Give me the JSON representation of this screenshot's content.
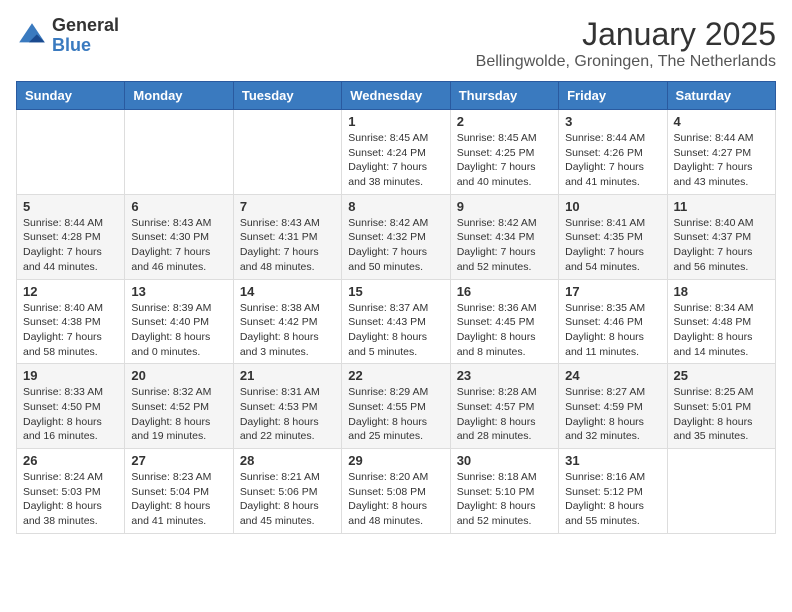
{
  "logo": {
    "general": "General",
    "blue": "Blue"
  },
  "header": {
    "month": "January 2025",
    "location": "Bellingwolde, Groningen, The Netherlands"
  },
  "weekdays": [
    "Sunday",
    "Monday",
    "Tuesday",
    "Wednesday",
    "Thursday",
    "Friday",
    "Saturday"
  ],
  "weeks": [
    [
      {
        "day": "",
        "info": ""
      },
      {
        "day": "",
        "info": ""
      },
      {
        "day": "",
        "info": ""
      },
      {
        "day": "1",
        "info": "Sunrise: 8:45 AM\nSunset: 4:24 PM\nDaylight: 7 hours\nand 38 minutes."
      },
      {
        "day": "2",
        "info": "Sunrise: 8:45 AM\nSunset: 4:25 PM\nDaylight: 7 hours\nand 40 minutes."
      },
      {
        "day": "3",
        "info": "Sunrise: 8:44 AM\nSunset: 4:26 PM\nDaylight: 7 hours\nand 41 minutes."
      },
      {
        "day": "4",
        "info": "Sunrise: 8:44 AM\nSunset: 4:27 PM\nDaylight: 7 hours\nand 43 minutes."
      }
    ],
    [
      {
        "day": "5",
        "info": "Sunrise: 8:44 AM\nSunset: 4:28 PM\nDaylight: 7 hours\nand 44 minutes."
      },
      {
        "day": "6",
        "info": "Sunrise: 8:43 AM\nSunset: 4:30 PM\nDaylight: 7 hours\nand 46 minutes."
      },
      {
        "day": "7",
        "info": "Sunrise: 8:43 AM\nSunset: 4:31 PM\nDaylight: 7 hours\nand 48 minutes."
      },
      {
        "day": "8",
        "info": "Sunrise: 8:42 AM\nSunset: 4:32 PM\nDaylight: 7 hours\nand 50 minutes."
      },
      {
        "day": "9",
        "info": "Sunrise: 8:42 AM\nSunset: 4:34 PM\nDaylight: 7 hours\nand 52 minutes."
      },
      {
        "day": "10",
        "info": "Sunrise: 8:41 AM\nSunset: 4:35 PM\nDaylight: 7 hours\nand 54 minutes."
      },
      {
        "day": "11",
        "info": "Sunrise: 8:40 AM\nSunset: 4:37 PM\nDaylight: 7 hours\nand 56 minutes."
      }
    ],
    [
      {
        "day": "12",
        "info": "Sunrise: 8:40 AM\nSunset: 4:38 PM\nDaylight: 7 hours\nand 58 minutes."
      },
      {
        "day": "13",
        "info": "Sunrise: 8:39 AM\nSunset: 4:40 PM\nDaylight: 8 hours\nand 0 minutes."
      },
      {
        "day": "14",
        "info": "Sunrise: 8:38 AM\nSunset: 4:42 PM\nDaylight: 8 hours\nand 3 minutes."
      },
      {
        "day": "15",
        "info": "Sunrise: 8:37 AM\nSunset: 4:43 PM\nDaylight: 8 hours\nand 5 minutes."
      },
      {
        "day": "16",
        "info": "Sunrise: 8:36 AM\nSunset: 4:45 PM\nDaylight: 8 hours\nand 8 minutes."
      },
      {
        "day": "17",
        "info": "Sunrise: 8:35 AM\nSunset: 4:46 PM\nDaylight: 8 hours\nand 11 minutes."
      },
      {
        "day": "18",
        "info": "Sunrise: 8:34 AM\nSunset: 4:48 PM\nDaylight: 8 hours\nand 14 minutes."
      }
    ],
    [
      {
        "day": "19",
        "info": "Sunrise: 8:33 AM\nSunset: 4:50 PM\nDaylight: 8 hours\nand 16 minutes."
      },
      {
        "day": "20",
        "info": "Sunrise: 8:32 AM\nSunset: 4:52 PM\nDaylight: 8 hours\nand 19 minutes."
      },
      {
        "day": "21",
        "info": "Sunrise: 8:31 AM\nSunset: 4:53 PM\nDaylight: 8 hours\nand 22 minutes."
      },
      {
        "day": "22",
        "info": "Sunrise: 8:29 AM\nSunset: 4:55 PM\nDaylight: 8 hours\nand 25 minutes."
      },
      {
        "day": "23",
        "info": "Sunrise: 8:28 AM\nSunset: 4:57 PM\nDaylight: 8 hours\nand 28 minutes."
      },
      {
        "day": "24",
        "info": "Sunrise: 8:27 AM\nSunset: 4:59 PM\nDaylight: 8 hours\nand 32 minutes."
      },
      {
        "day": "25",
        "info": "Sunrise: 8:25 AM\nSunset: 5:01 PM\nDaylight: 8 hours\nand 35 minutes."
      }
    ],
    [
      {
        "day": "26",
        "info": "Sunrise: 8:24 AM\nSunset: 5:03 PM\nDaylight: 8 hours\nand 38 minutes."
      },
      {
        "day": "27",
        "info": "Sunrise: 8:23 AM\nSunset: 5:04 PM\nDaylight: 8 hours\nand 41 minutes."
      },
      {
        "day": "28",
        "info": "Sunrise: 8:21 AM\nSunset: 5:06 PM\nDaylight: 8 hours\nand 45 minutes."
      },
      {
        "day": "29",
        "info": "Sunrise: 8:20 AM\nSunset: 5:08 PM\nDaylight: 8 hours\nand 48 minutes."
      },
      {
        "day": "30",
        "info": "Sunrise: 8:18 AM\nSunset: 5:10 PM\nDaylight: 8 hours\nand 52 minutes."
      },
      {
        "day": "31",
        "info": "Sunrise: 8:16 AM\nSunset: 5:12 PM\nDaylight: 8 hours\nand 55 minutes."
      },
      {
        "day": "",
        "info": ""
      }
    ]
  ]
}
